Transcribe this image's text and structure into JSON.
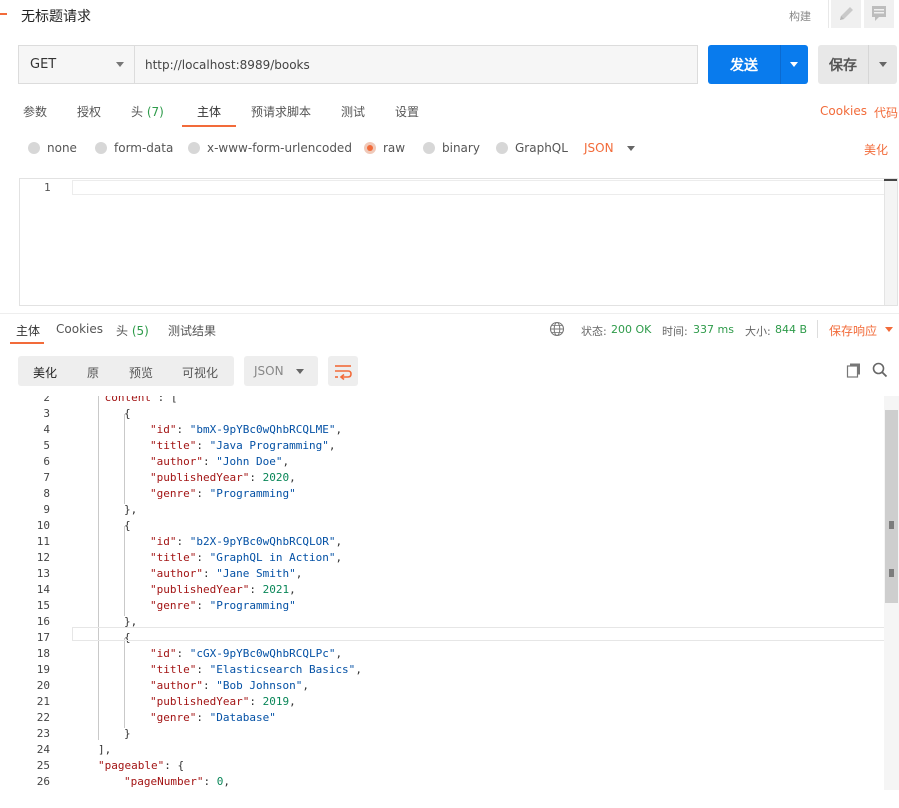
{
  "header": {
    "title": "无标题请求",
    "build_label": "构建",
    "icons": [
      "pencil-icon",
      "comment-icon"
    ]
  },
  "request": {
    "method": "GET",
    "url": "http://localhost:8989/books",
    "send_label": "发送",
    "save_label": "保存"
  },
  "request_tabs": {
    "params": "参数",
    "auth": "授权",
    "headers": "头",
    "headers_count": "(7)",
    "body": "主体",
    "pre_request": "预请求脚本",
    "tests": "测试",
    "settings": "设置",
    "active": "主体"
  },
  "links": {
    "cookies": "Cookies",
    "code": "代码",
    "beautify": "美化"
  },
  "body_types": {
    "options": [
      "none",
      "form-data",
      "x-www-form-urlencoded",
      "raw",
      "binary",
      "GraphQL"
    ],
    "selected": "raw",
    "format": "JSON"
  },
  "request_editor": {
    "line_number": "1"
  },
  "response": {
    "tabs": {
      "body": "主体",
      "cookies": "Cookies",
      "headers": "头",
      "headers_count": "(5)",
      "tests": "测试结果"
    },
    "status_label": "状态:",
    "status_value": "200 OK",
    "time_label": "时间:",
    "time_value": "337 ms",
    "size_label": "大小:",
    "size_value": "844 B",
    "save_response": "保存响应",
    "view_modes": {
      "pretty": "美化",
      "raw": "原",
      "preview": "预览",
      "visualize": "可视化"
    },
    "format": "JSON",
    "code_lines": [
      {
        "n": "2",
        "t": "\"content\": ["
      },
      {
        "n": "3",
        "t": "{"
      },
      {
        "n": "4",
        "t": "\"id\": \"bmX-9pYBc0wQhbRCQLME\","
      },
      {
        "n": "5",
        "t": "\"title\": \"Java Programming\","
      },
      {
        "n": "6",
        "t": "\"author\": \"John Doe\","
      },
      {
        "n": "7",
        "t": "\"publishedYear\": 2020,"
      },
      {
        "n": "8",
        "t": "\"genre\": \"Programming\""
      },
      {
        "n": "9",
        "t": "},"
      },
      {
        "n": "10",
        "t": "{"
      },
      {
        "n": "11",
        "t": "\"id\": \"b2X-9pYBc0wQhbRCQLOR\","
      },
      {
        "n": "12",
        "t": "\"title\": \"GraphQL in Action\","
      },
      {
        "n": "13",
        "t": "\"author\": \"Jane Smith\","
      },
      {
        "n": "14",
        "t": "\"publishedYear\": 2021,"
      },
      {
        "n": "15",
        "t": "\"genre\": \"Programming\""
      },
      {
        "n": "16",
        "t": "},"
      },
      {
        "n": "17",
        "t": "{"
      },
      {
        "n": "18",
        "t": "\"id\": \"cGX-9pYBc0wQhbRCQLPc\","
      },
      {
        "n": "19",
        "t": "\"title\": \"Elasticsearch Basics\","
      },
      {
        "n": "20",
        "t": "\"author\": \"Bob Johnson\","
      },
      {
        "n": "21",
        "t": "\"publishedYear\": 2019,"
      },
      {
        "n": "22",
        "t": "\"genre\": \"Database\""
      },
      {
        "n": "23",
        "t": "}"
      },
      {
        "n": "24",
        "t": "],"
      },
      {
        "n": "25",
        "t": "\"pageable\": {"
      },
      {
        "n": "26",
        "t": "\"pageNumber\": 0,"
      }
    ]
  },
  "colors": {
    "accent": "#f26b3a",
    "send_button": "#097bed",
    "success": "#2e9b4a"
  }
}
